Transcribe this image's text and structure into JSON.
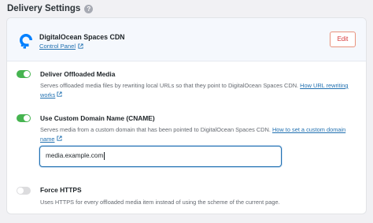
{
  "section": {
    "title": "Delivery Settings",
    "help_icon": "question-icon",
    "help_glyph": "?"
  },
  "provider": {
    "name": "DigitalOcean Spaces CDN",
    "logo_icon": "digitalocean-logo-icon",
    "control_panel_label": "Control Panel",
    "edit_label": "Edit",
    "accent_color": "#0080ff"
  },
  "settings": [
    {
      "title": "Deliver Offloaded Media",
      "enabled": true,
      "desc_text": "Serves offloaded media files by rewriting local URLs so that they point to DigitalOcean Spaces CDN. ",
      "link_label": "How URL rewriting works"
    },
    {
      "title": "Use Custom Domain Name (CNAME)",
      "enabled": true,
      "desc_text": "Serves media from a custom domain that has been pointed to DigitalOcean Spaces CDN. ",
      "link_label": "How to set a custom domain name",
      "input_value": "media.example.com"
    },
    {
      "title": "Force HTTPS",
      "enabled": false,
      "desc_text": "Uses HTTPS for every offloaded media item instead of using the scheme of the current page."
    }
  ],
  "colors": {
    "toggle_on": "#46b450",
    "toggle_off": "#dcdcde",
    "link": "#2271b1",
    "edit_border": "#e8927c"
  }
}
